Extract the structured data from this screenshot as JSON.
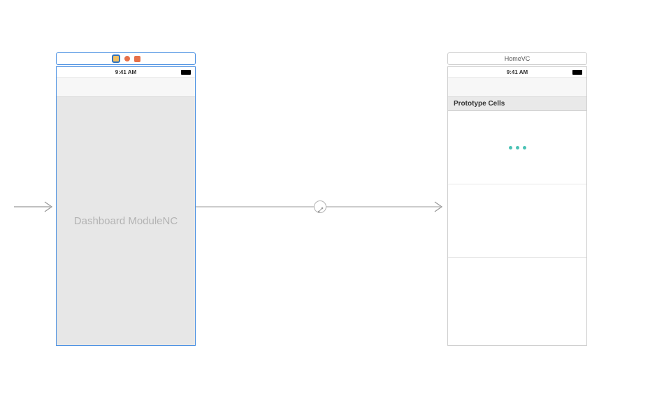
{
  "scene1": {
    "header_title": "",
    "status_time": "9:41 AM",
    "placeholder_label": "Dashboard ModuleNC"
  },
  "scene2": {
    "header_title": "HomeVC",
    "status_time": "9:41 AM",
    "section_header": "Prototype Cells"
  }
}
